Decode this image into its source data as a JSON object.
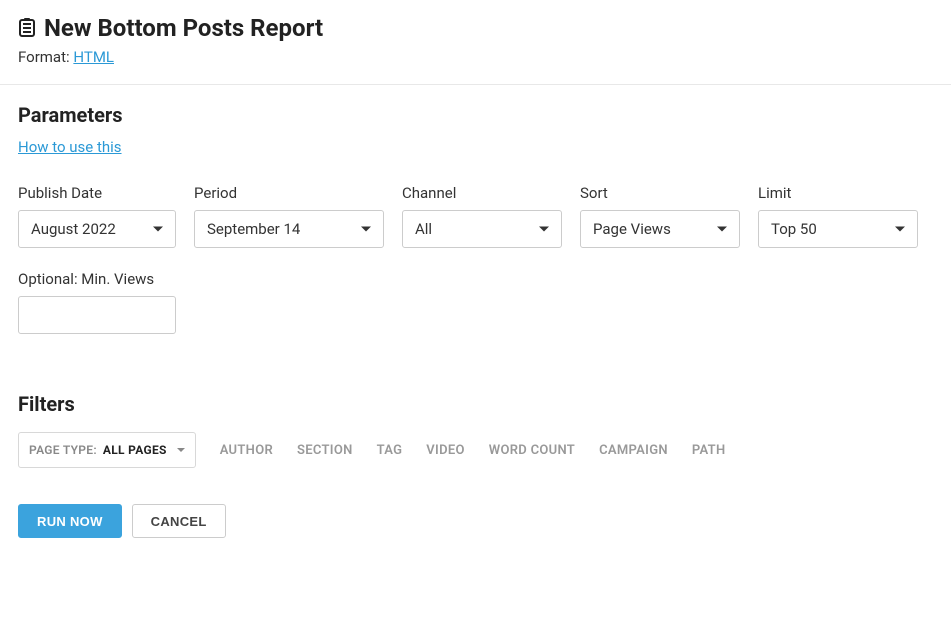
{
  "header": {
    "title": "New Bottom Posts Report",
    "format_label": "Format:",
    "format_value": "HTML"
  },
  "parameters": {
    "heading": "Parameters",
    "howto_link": "How to use this",
    "publish_date": {
      "label": "Publish Date",
      "value": "August 2022"
    },
    "period": {
      "label": "Period",
      "value": "September 14"
    },
    "channel": {
      "label": "Channel",
      "value": "All"
    },
    "sort": {
      "label": "Sort",
      "value": "Page Views"
    },
    "limit": {
      "label": "Limit",
      "value": "Top 50"
    },
    "min_views": {
      "label": "Optional: Min. Views",
      "value": ""
    }
  },
  "filters": {
    "heading": "Filters",
    "page_type_label": "PAGE TYPE:",
    "page_type_value": "ALL PAGES",
    "tabs": {
      "author": "AUTHOR",
      "section": "SECTION",
      "tag": "TAG",
      "video": "VIDEO",
      "word_count": "WORD COUNT",
      "campaign": "CAMPAIGN",
      "path": "PATH"
    }
  },
  "actions": {
    "run": "RUN NOW",
    "cancel": "CANCEL"
  }
}
